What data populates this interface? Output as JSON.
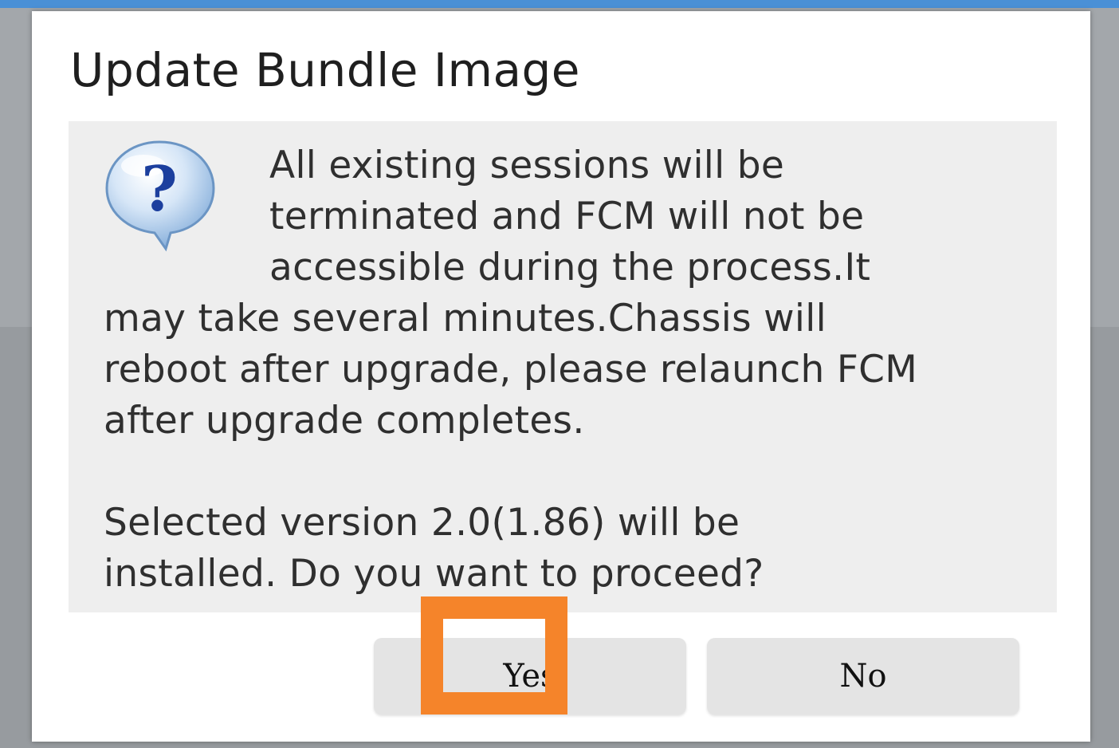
{
  "dialog": {
    "title": "Update Bundle Image",
    "icon": "question-bubble-icon",
    "message": {
      "line1": "All existing sessions will be",
      "line2": "terminated and FCM will not be",
      "line3": "accessible during the process.It",
      "line4": "may take several minutes.Chassis will",
      "line5": "reboot after upgrade, please relaunch FCM",
      "line6": "after upgrade completes.",
      "line7": "Selected version 2.0(1.86) will be",
      "line8": "installed. Do you want to proceed?"
    },
    "buttons": {
      "yes_label": "Yes",
      "no_label": "No"
    }
  },
  "colors": {
    "highlight": "#f5842a",
    "panel": "#eeeeee",
    "button": "#e4e4e4"
  }
}
